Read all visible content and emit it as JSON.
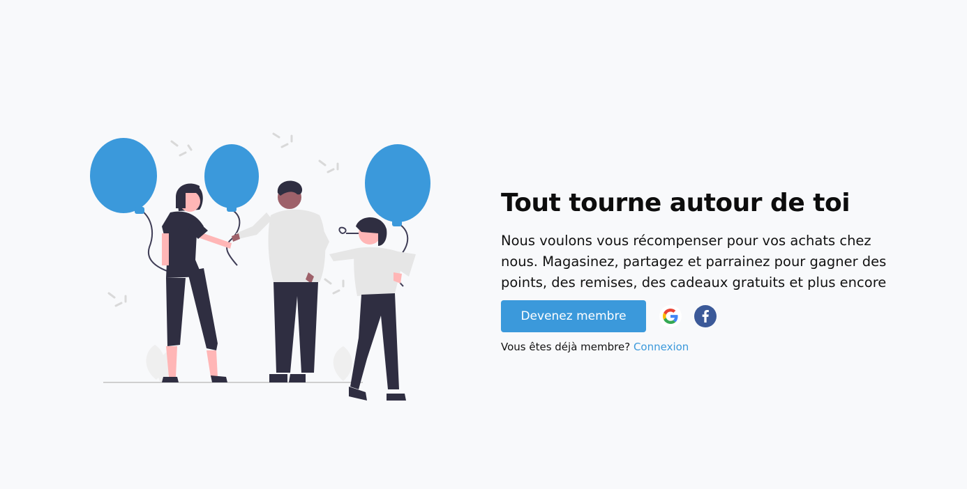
{
  "hero": {
    "headline": "Tout tourne autour de toi",
    "description": "Nous voulons vous récompenser pour vos achats chez nous. Magasinez, partagez et parrainez pour gagner des points, des remises, des cadeaux gratuits et plus encore",
    "cta_label": "Devenez membre",
    "already_member_text": "Vous êtes déjà membre?",
    "login_link_label": "Connexion"
  },
  "social": {
    "google_icon": "google-icon",
    "facebook_icon": "facebook-icon"
  },
  "colors": {
    "background": "#f8f9fb",
    "accent": "#3b99db",
    "balloon": "#3b99db",
    "dark": "#2f2e41",
    "skin": "#ffb6b6",
    "shirt": "#e6e6e6",
    "facebook": "#3b5998"
  }
}
